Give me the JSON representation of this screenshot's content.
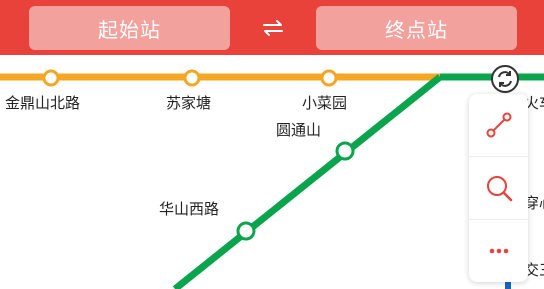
{
  "header": {
    "start_placeholder": "起始站",
    "end_placeholder": "终点站",
    "swap_icon": "swap-arrows-icon"
  },
  "colors": {
    "header_bg": "#e8423b",
    "input_bg": "#f3a19c",
    "line_orange": "#f5a623",
    "line_green": "#09a44b",
    "line_blue": "#1565c0",
    "accent": "#e8423b"
  },
  "stations": {
    "jindingshan": "金鼎山北路",
    "sujiatang": "苏家塘",
    "xiaocaiyuan": "小菜园",
    "yuantongshan": "圆通山",
    "huashanxilu": "华山西路",
    "huo_partial": "火车",
    "chuan_partial": "穿心",
    "jiao_partial": "交三"
  },
  "toolbar": {
    "route_icon": "route-icon",
    "search_icon": "search-icon",
    "more_icon": "more-dots-icon",
    "locate_icon": "refresh-locate-icon"
  }
}
